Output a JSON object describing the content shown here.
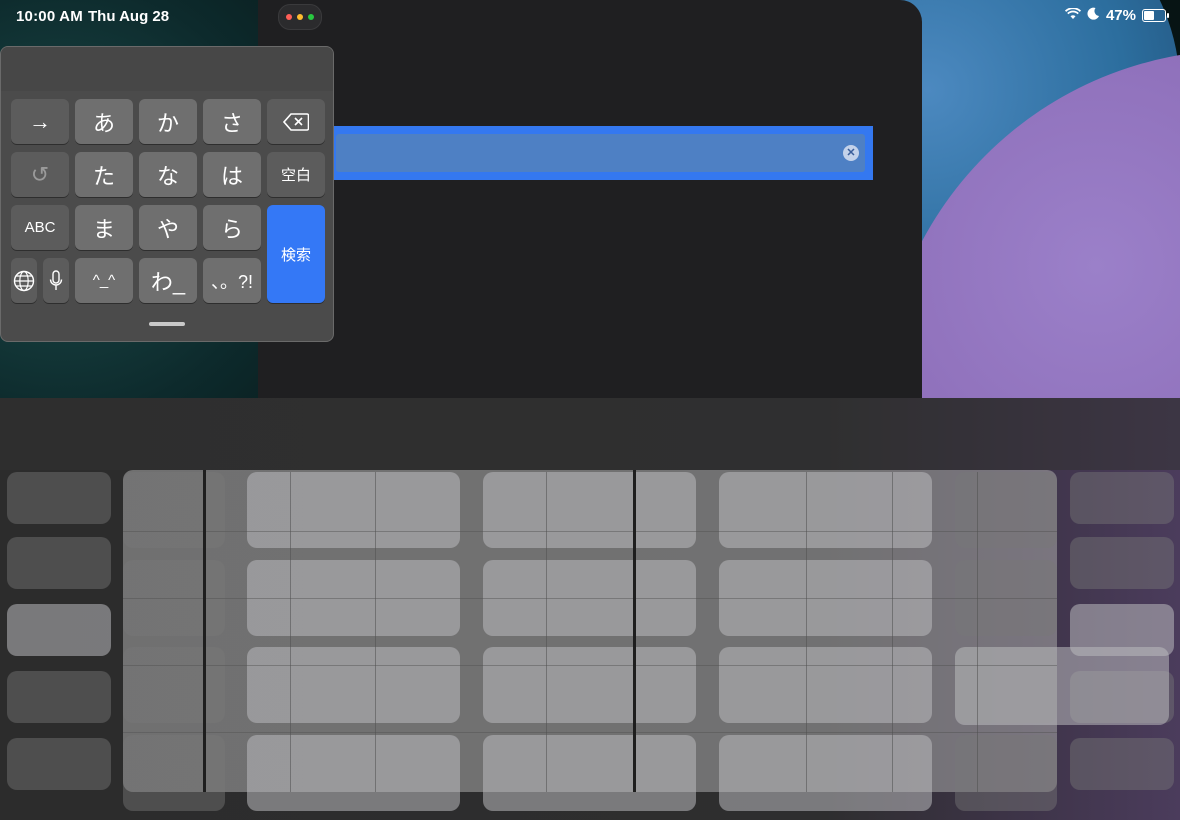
{
  "status_bar": {
    "time": "10:00 AM",
    "date": "Thu Aug 28",
    "battery_percent": "47%",
    "icons": [
      "wifi-icon",
      "moon-icon",
      "battery-icon"
    ]
  },
  "window": {
    "dots_colors": [
      "#ff5f57",
      "#febc2e",
      "#28c840"
    ]
  },
  "search": {
    "value": "",
    "placeholder": "",
    "clear_icon": "clear-icon"
  },
  "floating_keyboard": {
    "row1": [
      "→",
      "あ",
      "か",
      "さ",
      "⌫"
    ],
    "row2": [
      "↺",
      "た",
      "な",
      "は",
      "空白"
    ],
    "row3": [
      "ABC",
      "ま",
      "や",
      "ら"
    ],
    "row4": [
      "🌐",
      "🎤",
      "^_^",
      "わ_",
      "、。?!"
    ],
    "search_key": "検索"
  },
  "colors": {
    "accent": "#3478f6",
    "window_bg": "#1f1f21",
    "key_bg": "#6f6f6f"
  }
}
